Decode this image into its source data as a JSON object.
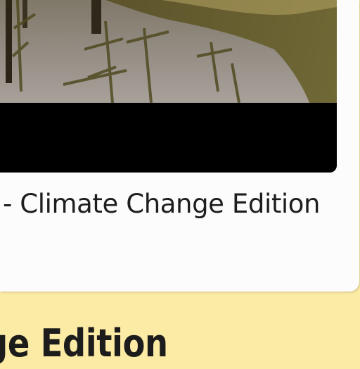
{
  "card": {
    "thumbnail_alt": "",
    "caption": "- Climate Change Edition"
  },
  "section": {
    "heading": "ge Edition"
  },
  "colors": {
    "page_background": "#fbeba4",
    "card_background": "#fdfcfd",
    "media_background": "#000000",
    "text": "#1d1d1f"
  }
}
